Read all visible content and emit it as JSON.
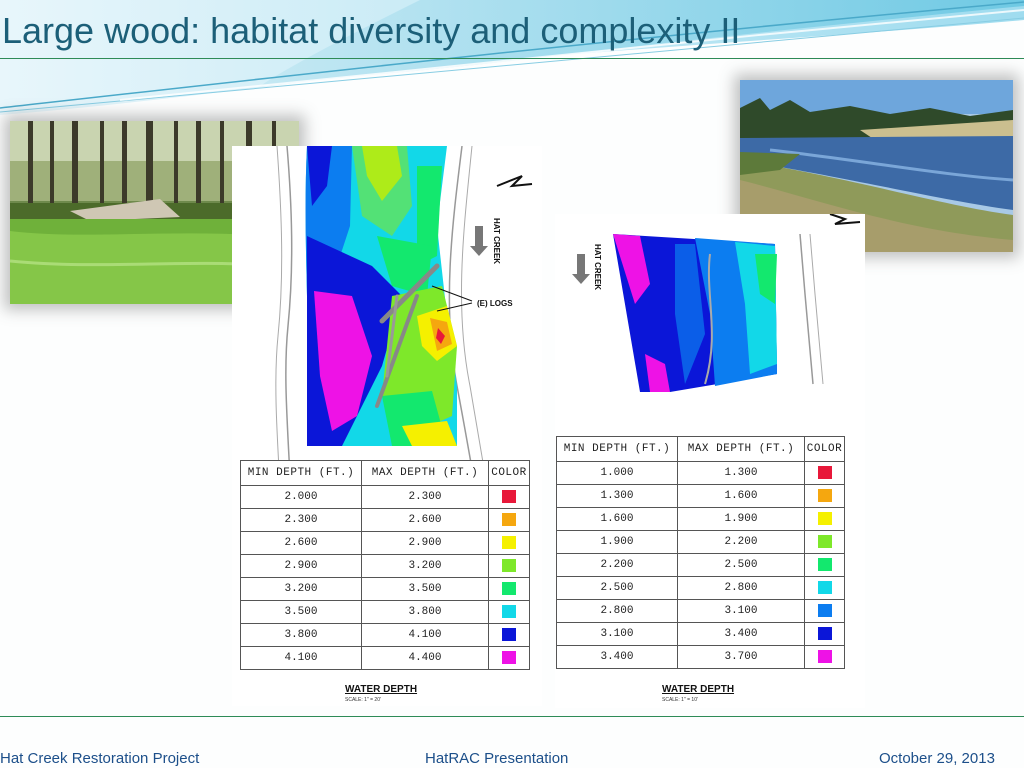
{
  "title": "Large wood: habitat diversity and complexity II",
  "colors": {
    "title": "#1c5f78",
    "accent_rule": "#2e8b57",
    "footer_text": "#1c4f8a",
    "depth_red": "#e8183a",
    "depth_orange": "#f5a70f",
    "depth_yellow": "#f5f000",
    "depth_light_green": "#7ee82a",
    "depth_green": "#13e86e",
    "depth_cyan": "#12d8e8",
    "depth_blue": "#0c7df0",
    "depth_dark_blue": "#0b16d8",
    "depth_magenta": "#ee12e6"
  },
  "map_left": {
    "logs_label": "(E) LOGS",
    "creek_label": "HAT CREEK",
    "caption": "WATER DEPTH",
    "scale": "SCALE: 1\" = 20'"
  },
  "map_right": {
    "creek_label": "HAT CREEK",
    "caption": "WATER DEPTH",
    "scale": "SCALE: 1\" = 10'"
  },
  "legend_left": {
    "headers": [
      "MIN  DEPTH  (FT.)",
      "MAX  DEPTH  (FT.)",
      "COLOR"
    ],
    "rows": [
      {
        "min": "2.000",
        "max": "2.300",
        "color": "#e8183a"
      },
      {
        "min": "2.300",
        "max": "2.600",
        "color": "#f5a70f"
      },
      {
        "min": "2.600",
        "max": "2.900",
        "color": "#f5f000"
      },
      {
        "min": "2.900",
        "max": "3.200",
        "color": "#7ee82a"
      },
      {
        "min": "3.200",
        "max": "3.500",
        "color": "#13e86e"
      },
      {
        "min": "3.500",
        "max": "3.800",
        "color": "#12d8e8"
      },
      {
        "min": "3.800",
        "max": "4.100",
        "color": "#0b16d8"
      },
      {
        "min": "4.100",
        "max": "4.400",
        "color": "#ee12e6"
      }
    ]
  },
  "legend_right": {
    "headers": [
      "MIN  DEPTH  (FT.)",
      "MAX  DEPTH  (FT.)",
      "COLOR"
    ],
    "rows": [
      {
        "min": "1.000",
        "max": "1.300",
        "color": "#e8183a"
      },
      {
        "min": "1.300",
        "max": "1.600",
        "color": "#f5a70f"
      },
      {
        "min": "1.600",
        "max": "1.900",
        "color": "#f5f000"
      },
      {
        "min": "1.900",
        "max": "2.200",
        "color": "#7ee82a"
      },
      {
        "min": "2.200",
        "max": "2.500",
        "color": "#13e86e"
      },
      {
        "min": "2.500",
        "max": "2.800",
        "color": "#12d8e8"
      },
      {
        "min": "2.800",
        "max": "3.100",
        "color": "#0c7df0"
      },
      {
        "min": "3.100",
        "max": "3.400",
        "color": "#0b16d8"
      },
      {
        "min": "3.400",
        "max": "3.700",
        "color": "#ee12e6"
      }
    ]
  },
  "footer": {
    "left": "Hat Creek Restoration Project",
    "center": "HatRAC Presentation",
    "right": "October 29, 2013"
  }
}
